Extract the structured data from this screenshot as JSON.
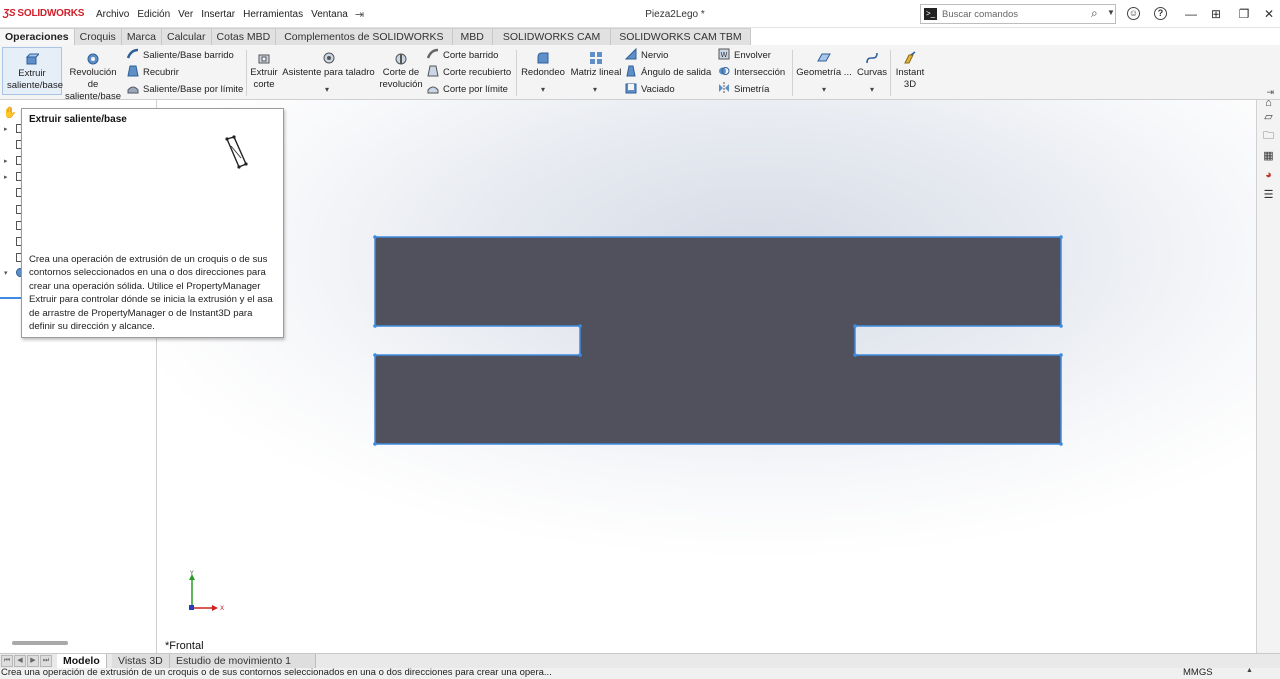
{
  "app": {
    "brand": "SOLIDWORKS",
    "doc_title": "Pieza2Lego *"
  },
  "menu": [
    "Archivo",
    "Edición",
    "Ver",
    "Insertar",
    "Herramientas",
    "Ventana"
  ],
  "search": {
    "placeholder": "Buscar comandos"
  },
  "tabs": [
    "Operaciones",
    "Croquis",
    "Marca",
    "Calcular",
    "Cotas MBD",
    "Complementos de SOLIDWORKS",
    "MBD",
    "SOLIDWORKS CAM",
    "SOLIDWORKS CAM TBM"
  ],
  "ribbon": {
    "extruir_saliente": "Extruir saliente/base",
    "revolucion_saliente": "Revolución de saliente/base",
    "saliente_barrido": "Saliente/Base barrido",
    "recubrir": "Recubrir",
    "saliente_limite": "Saliente/Base por límite",
    "extruir_corte": "Extruir corte",
    "asistente_taladro": "Asistente para taladro",
    "corte_revolucion": "Corte de revolución",
    "corte_barrido": "Corte barrido",
    "corte_recubierto": "Corte recubierto",
    "corte_limite": "Corte por límite",
    "redondeo": "Redondeo",
    "matriz_lineal": "Matriz lineal",
    "nervio": "Nervio",
    "angulo_salida": "Ángulo de salida",
    "vaciado": "Vaciado",
    "envolver": "Envolver",
    "interseccion": "Intersección",
    "simetria": "Simetría",
    "geometria": "Geometría ...",
    "curvas": "Curvas",
    "instant3d": "Instant 3D"
  },
  "tooltip": {
    "title": "Extruir saliente/base",
    "body": "Crea una operación de extrusión de un croquis o de sus contornos seleccionados en una o dos direcciones para crear una operación sólida. Utilice el PropertyManager Extruir para controlar dónde se inicia la extrusión y el asa de arrastre de PropertyManager o de Instant3D para definir su dirección y alcance."
  },
  "graphics": {
    "view_label": "*Frontal",
    "triad": {
      "x": "X",
      "y": "Y"
    }
  },
  "bottom_tabs": [
    "Modelo",
    "Vistas 3D",
    "Estudio de movimiento 1"
  ],
  "status": {
    "text": "Crea una operación de extrusión de un croquis o de sus contornos seleccionados en una o dos direcciones para crear una opera...",
    "units": "MMGS"
  },
  "colors": {
    "sketch_fill": "#50515c",
    "sketch_edge": "#3f8be0",
    "brand_red": "#d0202a"
  }
}
